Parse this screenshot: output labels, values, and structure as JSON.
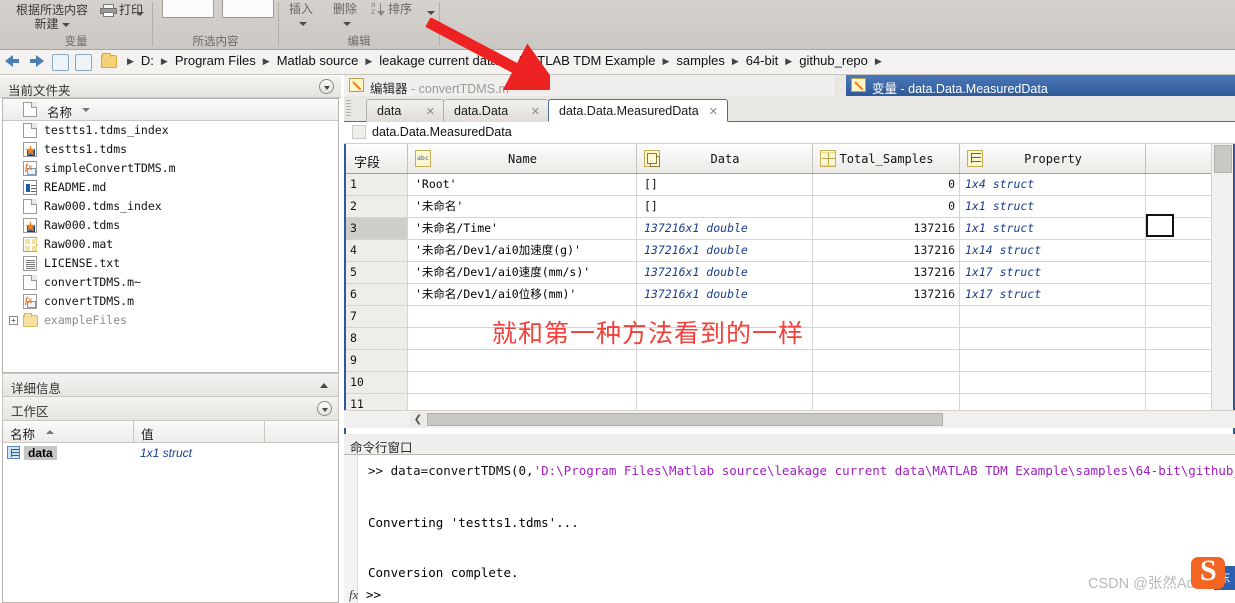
{
  "ribbon": {
    "groups": [
      {
        "caption": "变量",
        "buttons": [
          {
            "label": "根据所选内容",
            "sub": "新建"
          },
          {
            "label": "打印"
          }
        ]
      },
      {
        "caption": "所选内容",
        "buttons": []
      },
      {
        "caption": "编辑",
        "buttons": [
          {
            "label": "插入"
          },
          {
            "label": "删除"
          },
          {
            "label": "排序"
          }
        ]
      }
    ]
  },
  "address": {
    "crumbs": [
      "D:",
      "Program Files",
      "Matlab source",
      "leakage current data",
      "MATLAB TDM Example",
      "samples",
      "64-bit",
      "github_repo"
    ]
  },
  "current_folder": {
    "title": "当前文件夹",
    "column_header": "名称",
    "files": [
      {
        "name": "testts1.tdms_index",
        "icon": "document-icon"
      },
      {
        "name": "testts1.tdms",
        "icon": "tdms-file-icon"
      },
      {
        "name": "simpleConvertTDMS.m",
        "icon": "matlab-m-file-icon"
      },
      {
        "name": "README.md",
        "icon": "markdown-file-icon"
      },
      {
        "name": "Raw000.tdms_index",
        "icon": "document-icon"
      },
      {
        "name": "Raw000.tdms",
        "icon": "tdms-file-icon"
      },
      {
        "name": "Raw000.mat",
        "icon": "mat-file-icon"
      },
      {
        "name": "LICENSE.txt",
        "icon": "text-file-icon"
      },
      {
        "name": "convertTDMS.m~",
        "icon": "document-icon"
      },
      {
        "name": "convertTDMS.m",
        "icon": "matlab-m-file-icon"
      },
      {
        "name": "exampleFiles",
        "icon": "folder-icon"
      }
    ]
  },
  "details_panel": {
    "title": "详细信息"
  },
  "workspace": {
    "title": "工作区",
    "columns": [
      "名称",
      "值"
    ],
    "rows": [
      {
        "name": "data",
        "value": "1x1 struct"
      }
    ]
  },
  "editor_titlebar": {
    "prefix": "编辑器",
    "sep": " - ",
    "file": "convertTDMS.m"
  },
  "variable_titlebar": {
    "prefix": "变量",
    "sep": " - ",
    "name": "data.Data.MeasuredData"
  },
  "tabs": [
    {
      "label": "data",
      "active": false
    },
    {
      "label": "data.Data",
      "active": false
    },
    {
      "label": "data.Data.MeasuredData",
      "active": true
    }
  ],
  "breadcrumb_var": "data.Data.MeasuredData",
  "table": {
    "columns": [
      {
        "label": "字段",
        "icon": "none"
      },
      {
        "label": "Name",
        "icon": "abc-string-icon"
      },
      {
        "label": "Data",
        "icon": "cell-array-icon"
      },
      {
        "label": "Total_Samples",
        "icon": "matrix-icon"
      },
      {
        "label": "Property",
        "icon": "struct-icon"
      }
    ],
    "rows": [
      {
        "n": "1",
        "name": "'Root'",
        "data": "[]",
        "data_italic": false,
        "total": "0",
        "property": "1x4 struct",
        "selected": false
      },
      {
        "n": "2",
        "name": "'未命名'",
        "data": "[]",
        "data_italic": false,
        "total": "0",
        "property": "1x1 struct",
        "selected": false
      },
      {
        "n": "3",
        "name": "'未命名/Time'",
        "data": "137216x1 double",
        "data_italic": true,
        "total": "137216",
        "property": "1x1 struct",
        "selected": true
      },
      {
        "n": "4",
        "name": "'未命名/Dev1/ai0加速度(g)'",
        "data": "137216x1 double",
        "data_italic": true,
        "total": "137216",
        "property": "1x14 struct",
        "selected": false
      },
      {
        "n": "5",
        "name": "'未命名/Dev1/ai0速度(mm/s)'",
        "data": "137216x1 double",
        "data_italic": true,
        "total": "137216",
        "property": "1x17 struct",
        "selected": false
      },
      {
        "n": "6",
        "name": "'未命名/Dev1/ai0位移(mm)'",
        "data": "137216x1 double",
        "data_italic": true,
        "total": "137216",
        "property": "1x17 struct",
        "selected": false
      },
      {
        "n": "7",
        "name": "",
        "data": "",
        "data_italic": false,
        "total": "",
        "property": "",
        "selected": false
      },
      {
        "n": "8",
        "name": "",
        "data": "",
        "data_italic": false,
        "total": "",
        "property": "",
        "selected": false
      },
      {
        "n": "9",
        "name": "",
        "data": "",
        "data_italic": false,
        "total": "",
        "property": "",
        "selected": false
      },
      {
        "n": "10",
        "name": "",
        "data": "",
        "data_italic": false,
        "total": "",
        "property": "",
        "selected": false
      },
      {
        "n": "11",
        "name": "",
        "data": "",
        "data_italic": false,
        "total": "",
        "property": "",
        "selected": false
      }
    ]
  },
  "annotation": {
    "red_text": "就和第一种方法看到的一样"
  },
  "command_window": {
    "title": "命令行窗口",
    "prompt": ">> ",
    "command_head": "data=convertTDMS(0,",
    "command_string": "'D:\\Program Files\\Matlab source\\leakage current data\\MATLAB TDM Example\\samples\\64-bit\\github_repo\\tes",
    "output_1": "Converting 'testts1.tdms'...",
    "output_2": "Conversion complete.",
    "final_prompt": ">>",
    "fx": "fx"
  },
  "watermark": {
    "text": "CSDN @张然Adolf",
    "logo": "S"
  }
}
